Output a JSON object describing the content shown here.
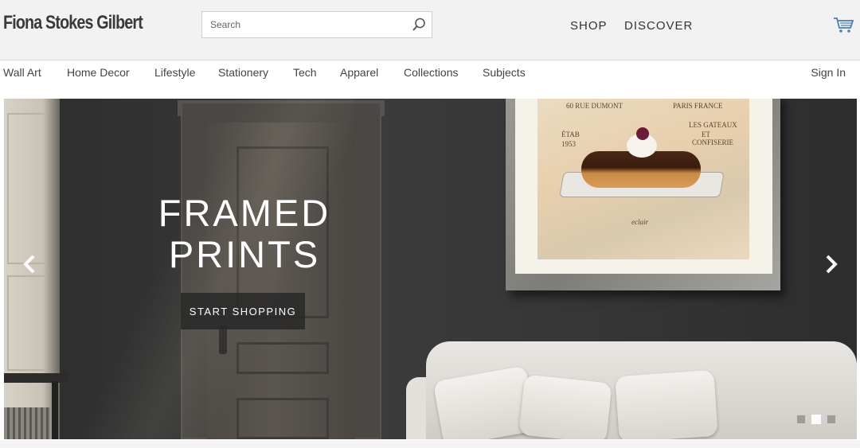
{
  "header": {
    "brand": "Fiona Stokes Gilbert",
    "search_placeholder": "Search",
    "nav": [
      "SHOP",
      "DISCOVER"
    ],
    "cart_icon": "cart-icon",
    "search_icon": "search-icon"
  },
  "categories": [
    "Wall Art",
    "Home Decor",
    "Lifestyle",
    "Stationery",
    "Tech",
    "Apparel",
    "Collections",
    "Subjects"
  ],
  "account": {
    "sign_in": "Sign In"
  },
  "hero": {
    "title_line1": "FRAMED",
    "title_line2": "PRINTS",
    "cta_label": "START SHOPPING",
    "prev_icon": "chevron-left-icon",
    "next_icon": "chevron-right-icon",
    "slide_count": 3,
    "active_slide": 2,
    "artwork_text": [
      "60 RUE DUMONT",
      "PARIS FRANCE",
      "ÉTAB",
      "1953",
      "LES GATEAUX",
      "ET",
      "CONFISERIE",
      "eclair"
    ]
  },
  "colors": {
    "header_bg": "#f2f2f2",
    "text": "#444444",
    "hero_wall": "#3a3a3a",
    "cta_bg": "#282828"
  }
}
